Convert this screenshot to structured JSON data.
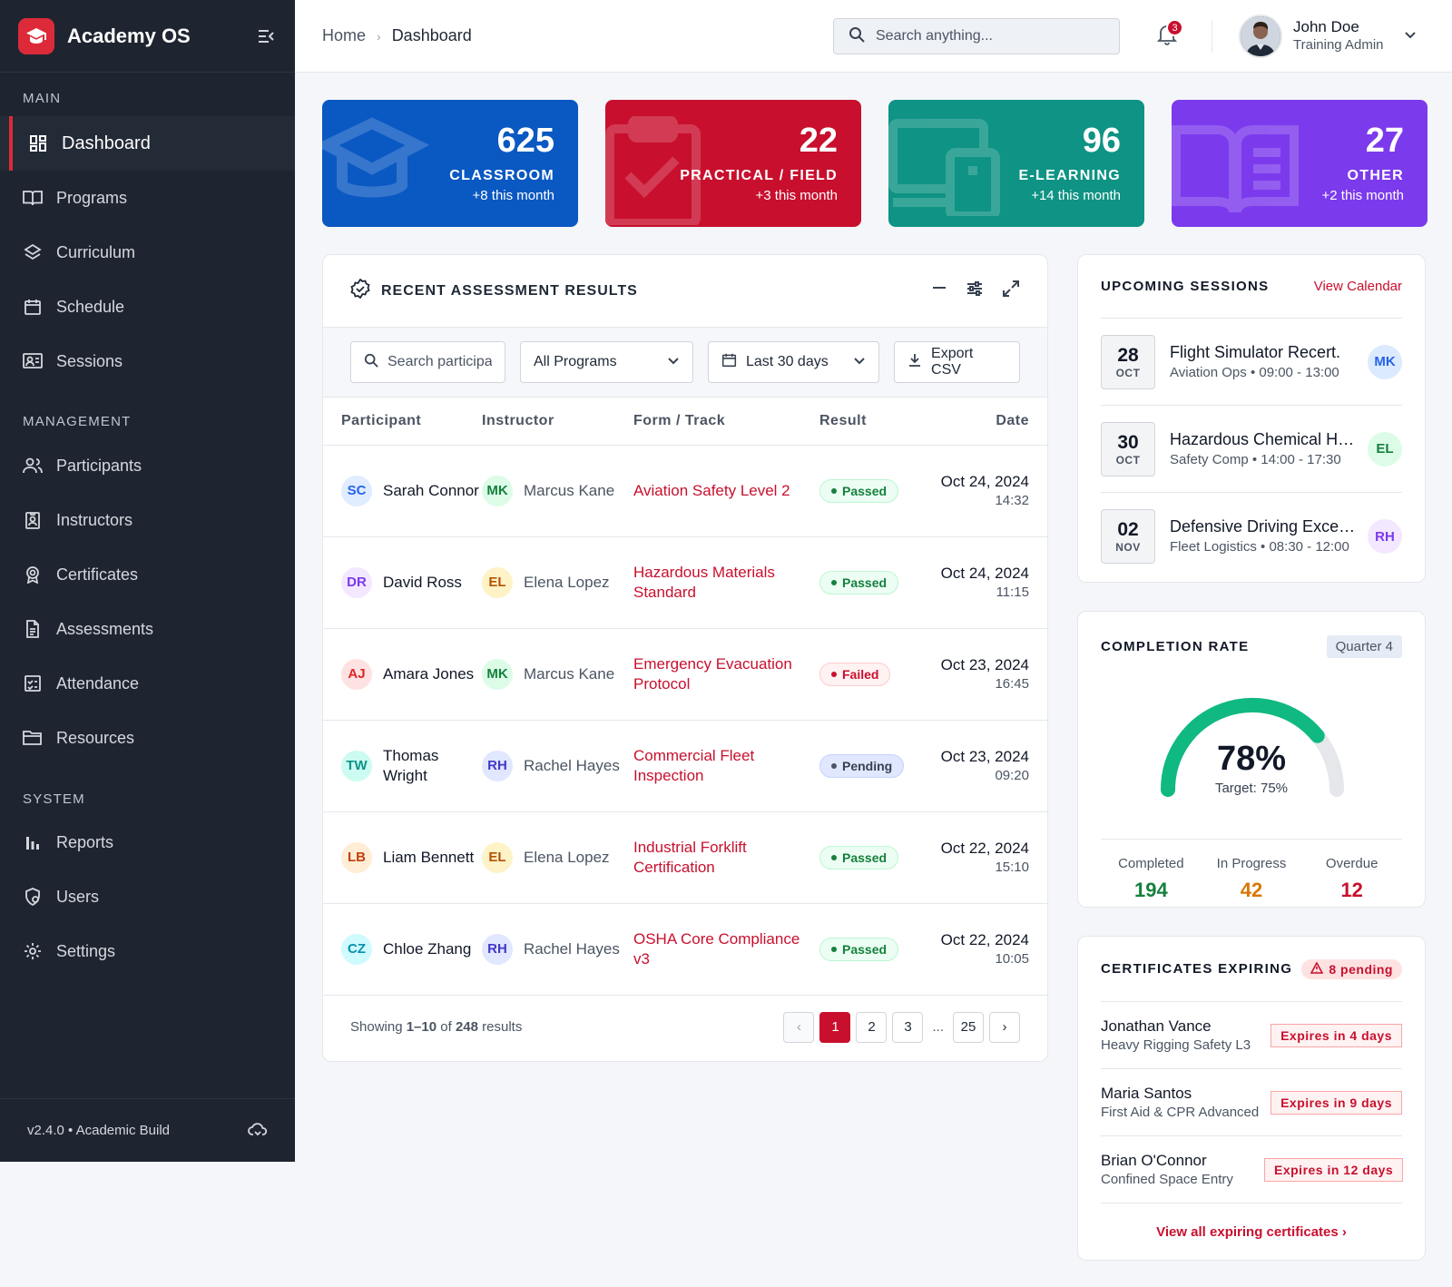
{
  "app": {
    "name": "Academy OS",
    "version": "v2.4.0 • Academic Build",
    "accent": "#dc2a38"
  },
  "sidebar": {
    "sections": [
      {
        "title": "MAIN",
        "items": [
          {
            "label": "Dashboard",
            "icon": "grid-icon",
            "active": true
          },
          {
            "label": "Programs",
            "icon": "book-open-icon"
          },
          {
            "label": "Curriculum",
            "icon": "layers-icon"
          },
          {
            "label": "Schedule",
            "icon": "calendar-icon"
          },
          {
            "label": "Sessions",
            "icon": "presentation-icon"
          }
        ]
      },
      {
        "title": "MANAGEMENT",
        "items": [
          {
            "label": "Participants",
            "icon": "users-icon"
          },
          {
            "label": "Instructors",
            "icon": "id-badge-icon"
          },
          {
            "label": "Certificates",
            "icon": "award-icon"
          },
          {
            "label": "Assessments",
            "icon": "file-text-icon"
          },
          {
            "label": "Attendance",
            "icon": "checklist-icon"
          },
          {
            "label": "Resources",
            "icon": "folder-icon"
          }
        ]
      },
      {
        "title": "SYSTEM",
        "items": [
          {
            "label": "Reports",
            "icon": "bar-chart-icon"
          },
          {
            "label": "Users",
            "icon": "user-shield-icon"
          },
          {
            "label": "Settings",
            "icon": "gear-icon"
          }
        ]
      }
    ]
  },
  "topbar": {
    "breadcrumb": [
      "Home",
      "Dashboard"
    ],
    "search_placeholder": "Search anything...",
    "notifications": "3",
    "user": {
      "name": "John Doe",
      "role": "Training Admin"
    }
  },
  "stats": [
    {
      "value": "625",
      "label": "CLASSROOM",
      "sub": "+8 this month",
      "color": "#0a58c2",
      "icon": "graduation-cap-icon"
    },
    {
      "value": "22",
      "label": "PRACTICAL / FIELD",
      "sub": "+3 this month",
      "color": "#c8102e",
      "icon": "clipboard-check-icon"
    },
    {
      "value": "96",
      "label": "E-LEARNING",
      "sub": "+14 this month",
      "color": "#0e9384",
      "icon": "devices-icon"
    },
    {
      "value": "27",
      "label": "OTHER",
      "sub": "+2 this month",
      "color": "#7c3aed",
      "icon": "book-icon"
    }
  ],
  "assessments": {
    "title": "RECENT ASSESSMENT RESULTS",
    "filters": {
      "search_placeholder": "Search participants",
      "program": "All Programs",
      "range": "Last 30 days",
      "export": "Export CSV"
    },
    "columns": [
      "Participant",
      "Instructor",
      "Form / Track",
      "Result",
      "Date"
    ],
    "rows": [
      {
        "p_ini": "SC",
        "p_name": "Sarah Connor",
        "p_color": "#2563eb",
        "p_bg": "#e0ecff",
        "i_ini": "MK",
        "i_name": "Marcus Kane",
        "i_color": "#15803d",
        "i_bg": "#dcfce7",
        "form": "Aviation Safety Level 2",
        "result": "Passed",
        "date": "Oct 24, 2024",
        "time": "14:32"
      },
      {
        "p_ini": "DR",
        "p_name": "David Ross",
        "p_color": "#7c3aed",
        "p_bg": "#f3e8ff",
        "i_ini": "EL",
        "i_name": "Elena Lopez",
        "i_color": "#b45309",
        "i_bg": "#fef3c7",
        "form": "Hazardous Materials Standard",
        "result": "Passed",
        "date": "Oct 24, 2024",
        "time": "11:15"
      },
      {
        "p_ini": "AJ",
        "p_name": "Amara Jones",
        "p_color": "#dc2626",
        "p_bg": "#fee2e2",
        "i_ini": "MK",
        "i_name": "Marcus Kane",
        "i_color": "#15803d",
        "i_bg": "#dcfce7",
        "form": "Emergency Evacuation Protocol",
        "result": "Failed",
        "date": "Oct 23, 2024",
        "time": "16:45"
      },
      {
        "p_ini": "TW",
        "p_name": "Thomas Wright",
        "p_color": "#0d9488",
        "p_bg": "#ccfbf1",
        "i_ini": "RH",
        "i_name": "Rachel Hayes",
        "i_color": "#4338ca",
        "i_bg": "#e0e7ff",
        "form": "Commercial Fleet Inspection",
        "result": "Pending",
        "date": "Oct 23, 2024",
        "time": "09:20"
      },
      {
        "p_ini": "LB",
        "p_name": "Liam Bennett",
        "p_color": "#c2410c",
        "p_bg": "#ffedd5",
        "i_ini": "EL",
        "i_name": "Elena Lopez",
        "i_color": "#b45309",
        "i_bg": "#fef3c7",
        "form": "Industrial Forklift Certification",
        "result": "Passed",
        "date": "Oct 22, 2024",
        "time": "15:10"
      },
      {
        "p_ini": "CZ",
        "p_name": "Chloe Zhang",
        "p_color": "#0891b2",
        "p_bg": "#cffafe",
        "i_ini": "RH",
        "i_name": "Rachel Hayes",
        "i_color": "#4338ca",
        "i_bg": "#e0e7ff",
        "form": "OSHA Core Compliance v3",
        "result": "Passed",
        "date": "Oct 22, 2024",
        "time": "10:05"
      }
    ],
    "footer": {
      "prefix": "Showing ",
      "range": "1–10",
      "mid": " of ",
      "total": "248",
      "suffix": " results"
    },
    "pages": [
      "1",
      "2",
      "3",
      "...",
      "25"
    ]
  },
  "sessions": {
    "title": "UPCOMING SESSIONS",
    "link": "View Calendar",
    "items": [
      {
        "day": "28",
        "month": "OCT",
        "title": "Flight Simulator Recert.",
        "sub": "Aviation Ops • 09:00 - 13:00",
        "ini": "MK",
        "color": "#2563eb",
        "bg": "#dbeafe"
      },
      {
        "day": "30",
        "month": "OCT",
        "title": "Hazardous Chemical Handling",
        "sub": "Safety Comp • 14:00 - 17:30",
        "ini": "EL",
        "color": "#15803d",
        "bg": "#dcfce7"
      },
      {
        "day": "02",
        "month": "NOV",
        "title": "Defensive Driving Excellence",
        "sub": "Fleet Logistics • 08:30 - 12:00",
        "ini": "RH",
        "color": "#7c3aed",
        "bg": "#f3e8ff"
      }
    ]
  },
  "completion": {
    "title": "COMPLETION RATE",
    "period": "Quarter 4",
    "value": 78,
    "value_label": "78%",
    "target": "Target: 75%",
    "stats": [
      {
        "label": "Completed",
        "value": "194",
        "color": "#15803d"
      },
      {
        "label": "In Progress",
        "value": "42",
        "color": "#d97706"
      },
      {
        "label": "Overdue",
        "value": "12",
        "color": "#c8102e"
      }
    ]
  },
  "certificates": {
    "title": "CERTIFICATES EXPIRING",
    "pending": "8 pending",
    "items": [
      {
        "name": "Jonathan Vance",
        "course": "Heavy Rigging Safety L3",
        "expires": "Expires in 4 days"
      },
      {
        "name": "Maria Santos",
        "course": "First Aid & CPR Advanced",
        "expires": "Expires in 9 days"
      },
      {
        "name": "Brian O'Connor",
        "course": "Confined Space Entry",
        "expires": "Expires in 12 days"
      }
    ],
    "link": "View all expiring certificates ›"
  }
}
